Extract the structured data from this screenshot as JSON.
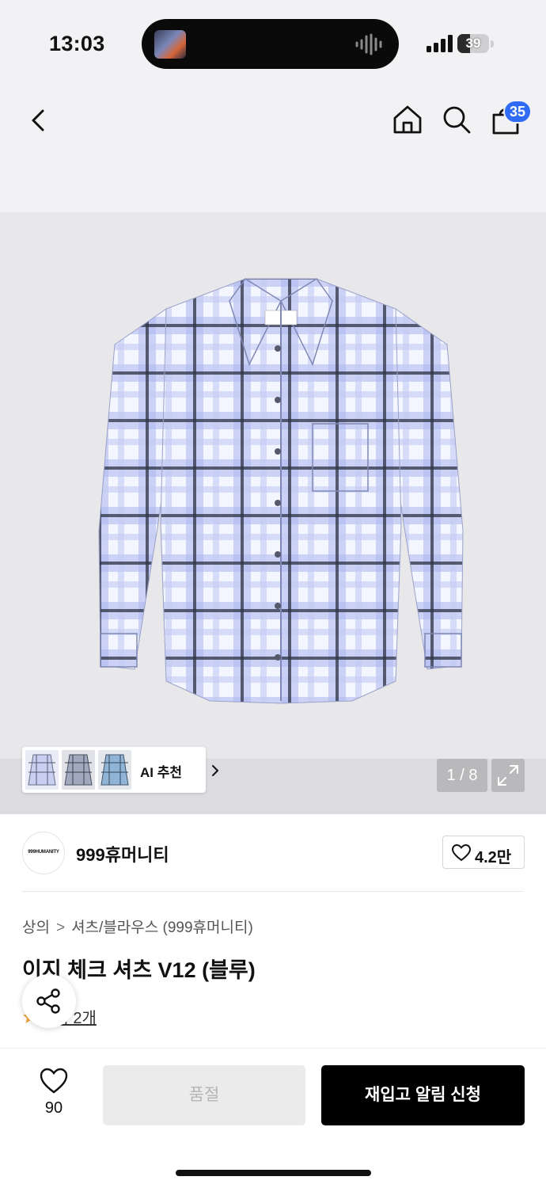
{
  "status_bar": {
    "time": "13:03",
    "battery": "39",
    "battery_level": 0.39
  },
  "nav": {
    "back_icon": "chevron-left-icon",
    "home_icon": "home-icon",
    "search_icon": "search-icon",
    "bag_icon": "shopping-bag-icon",
    "bag_count": "35",
    "badge_color": "#2f6bf5"
  },
  "gallery": {
    "ai_recommend_label": "AI 추천",
    "page_counter": "1 / 8",
    "expand_icon": "expand-icon"
  },
  "brand": {
    "logo_text": "999HUMANITY",
    "name": "999휴머니티",
    "likes": "4.2만"
  },
  "product": {
    "breadcrumb": [
      "상의",
      "셔츠/블라우스 (999휴머니티)"
    ],
    "title": "이지 체크 셔츠 V12 (블루)",
    "review_link": "후기 2개"
  },
  "bottom_bar": {
    "wish_count": "90",
    "soldout_label": "품절",
    "restock_label": "재입고 알림 신청"
  }
}
